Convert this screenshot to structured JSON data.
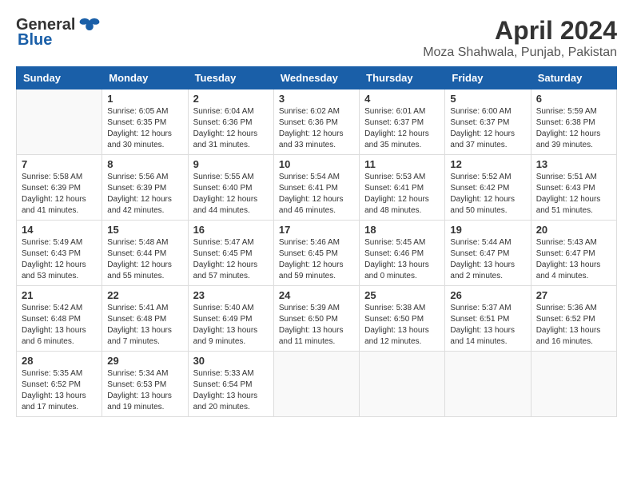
{
  "logo": {
    "general": "General",
    "blue": "Blue"
  },
  "title": "April 2024",
  "subtitle": "Moza Shahwala, Punjab, Pakistan",
  "days_of_week": [
    "Sunday",
    "Monday",
    "Tuesday",
    "Wednesday",
    "Thursday",
    "Friday",
    "Saturday"
  ],
  "weeks": [
    [
      {
        "num": "",
        "info": ""
      },
      {
        "num": "1",
        "info": "Sunrise: 6:05 AM\nSunset: 6:35 PM\nDaylight: 12 hours\nand 30 minutes."
      },
      {
        "num": "2",
        "info": "Sunrise: 6:04 AM\nSunset: 6:36 PM\nDaylight: 12 hours\nand 31 minutes."
      },
      {
        "num": "3",
        "info": "Sunrise: 6:02 AM\nSunset: 6:36 PM\nDaylight: 12 hours\nand 33 minutes."
      },
      {
        "num": "4",
        "info": "Sunrise: 6:01 AM\nSunset: 6:37 PM\nDaylight: 12 hours\nand 35 minutes."
      },
      {
        "num": "5",
        "info": "Sunrise: 6:00 AM\nSunset: 6:37 PM\nDaylight: 12 hours\nand 37 minutes."
      },
      {
        "num": "6",
        "info": "Sunrise: 5:59 AM\nSunset: 6:38 PM\nDaylight: 12 hours\nand 39 minutes."
      }
    ],
    [
      {
        "num": "7",
        "info": "Sunrise: 5:58 AM\nSunset: 6:39 PM\nDaylight: 12 hours\nand 41 minutes."
      },
      {
        "num": "8",
        "info": "Sunrise: 5:56 AM\nSunset: 6:39 PM\nDaylight: 12 hours\nand 42 minutes."
      },
      {
        "num": "9",
        "info": "Sunrise: 5:55 AM\nSunset: 6:40 PM\nDaylight: 12 hours\nand 44 minutes."
      },
      {
        "num": "10",
        "info": "Sunrise: 5:54 AM\nSunset: 6:41 PM\nDaylight: 12 hours\nand 46 minutes."
      },
      {
        "num": "11",
        "info": "Sunrise: 5:53 AM\nSunset: 6:41 PM\nDaylight: 12 hours\nand 48 minutes."
      },
      {
        "num": "12",
        "info": "Sunrise: 5:52 AM\nSunset: 6:42 PM\nDaylight: 12 hours\nand 50 minutes."
      },
      {
        "num": "13",
        "info": "Sunrise: 5:51 AM\nSunset: 6:43 PM\nDaylight: 12 hours\nand 51 minutes."
      }
    ],
    [
      {
        "num": "14",
        "info": "Sunrise: 5:49 AM\nSunset: 6:43 PM\nDaylight: 12 hours\nand 53 minutes."
      },
      {
        "num": "15",
        "info": "Sunrise: 5:48 AM\nSunset: 6:44 PM\nDaylight: 12 hours\nand 55 minutes."
      },
      {
        "num": "16",
        "info": "Sunrise: 5:47 AM\nSunset: 6:45 PM\nDaylight: 12 hours\nand 57 minutes."
      },
      {
        "num": "17",
        "info": "Sunrise: 5:46 AM\nSunset: 6:45 PM\nDaylight: 12 hours\nand 59 minutes."
      },
      {
        "num": "18",
        "info": "Sunrise: 5:45 AM\nSunset: 6:46 PM\nDaylight: 13 hours\nand 0 minutes."
      },
      {
        "num": "19",
        "info": "Sunrise: 5:44 AM\nSunset: 6:47 PM\nDaylight: 13 hours\nand 2 minutes."
      },
      {
        "num": "20",
        "info": "Sunrise: 5:43 AM\nSunset: 6:47 PM\nDaylight: 13 hours\nand 4 minutes."
      }
    ],
    [
      {
        "num": "21",
        "info": "Sunrise: 5:42 AM\nSunset: 6:48 PM\nDaylight: 13 hours\nand 6 minutes."
      },
      {
        "num": "22",
        "info": "Sunrise: 5:41 AM\nSunset: 6:48 PM\nDaylight: 13 hours\nand 7 minutes."
      },
      {
        "num": "23",
        "info": "Sunrise: 5:40 AM\nSunset: 6:49 PM\nDaylight: 13 hours\nand 9 minutes."
      },
      {
        "num": "24",
        "info": "Sunrise: 5:39 AM\nSunset: 6:50 PM\nDaylight: 13 hours\nand 11 minutes."
      },
      {
        "num": "25",
        "info": "Sunrise: 5:38 AM\nSunset: 6:50 PM\nDaylight: 13 hours\nand 12 minutes."
      },
      {
        "num": "26",
        "info": "Sunrise: 5:37 AM\nSunset: 6:51 PM\nDaylight: 13 hours\nand 14 minutes."
      },
      {
        "num": "27",
        "info": "Sunrise: 5:36 AM\nSunset: 6:52 PM\nDaylight: 13 hours\nand 16 minutes."
      }
    ],
    [
      {
        "num": "28",
        "info": "Sunrise: 5:35 AM\nSunset: 6:52 PM\nDaylight: 13 hours\nand 17 minutes."
      },
      {
        "num": "29",
        "info": "Sunrise: 5:34 AM\nSunset: 6:53 PM\nDaylight: 13 hours\nand 19 minutes."
      },
      {
        "num": "30",
        "info": "Sunrise: 5:33 AM\nSunset: 6:54 PM\nDaylight: 13 hours\nand 20 minutes."
      },
      {
        "num": "",
        "info": ""
      },
      {
        "num": "",
        "info": ""
      },
      {
        "num": "",
        "info": ""
      },
      {
        "num": "",
        "info": ""
      }
    ]
  ]
}
